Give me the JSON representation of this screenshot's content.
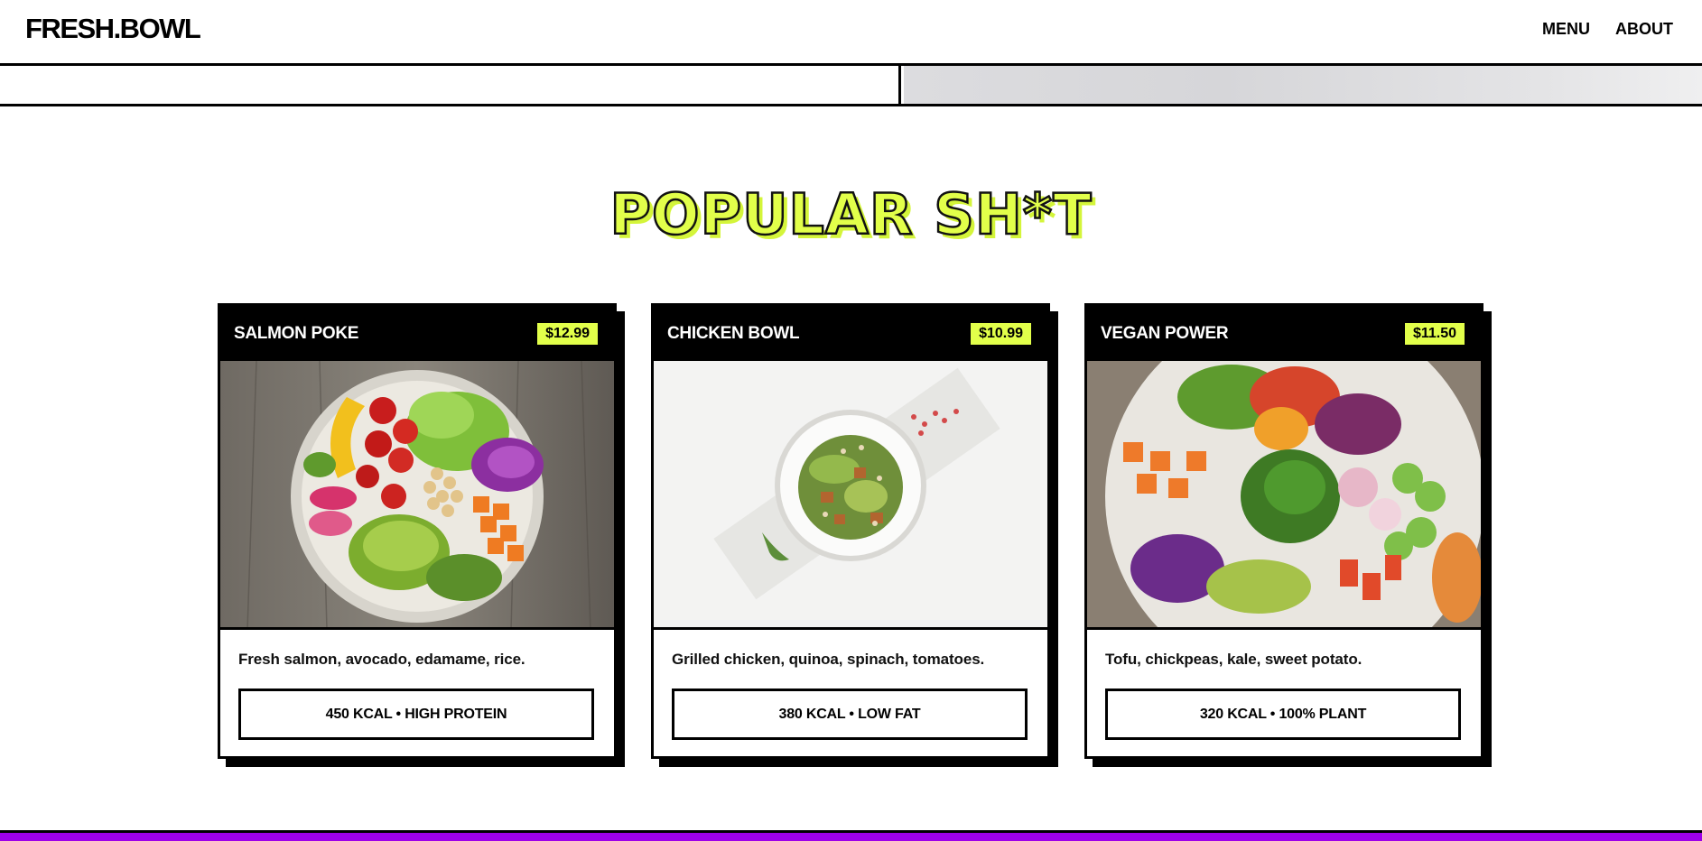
{
  "header": {
    "logo": "FRESH.BOWL",
    "nav": [
      {
        "label": "MENU"
      },
      {
        "label": "ABOUT"
      }
    ]
  },
  "section": {
    "title": "POPULAR SH*T"
  },
  "cards": [
    {
      "name": "SALMON POKE",
      "price": "$12.99",
      "description": "Fresh salmon, avocado, edamame, rice.",
      "tag": "450 KCAL • HIGH PROTEIN",
      "image": "salmon-poke-bowl-photo"
    },
    {
      "name": "CHICKEN BOWL",
      "price": "$10.99",
      "description": "Grilled chicken, quinoa, spinach, tomatoes.",
      "tag": "380 KCAL • LOW FAT",
      "image": "chicken-bowl-photo"
    },
    {
      "name": "VEGAN POWER",
      "price": "$11.50",
      "description": "Tofu, chickpeas, kale, sweet potato.",
      "tag": "320 KCAL • 100% PLANT",
      "image": "vegan-power-bowl-photo"
    }
  ],
  "colors": {
    "accent": "#e2ff4a",
    "footer": "#9d00e8",
    "ink": "#000000"
  }
}
